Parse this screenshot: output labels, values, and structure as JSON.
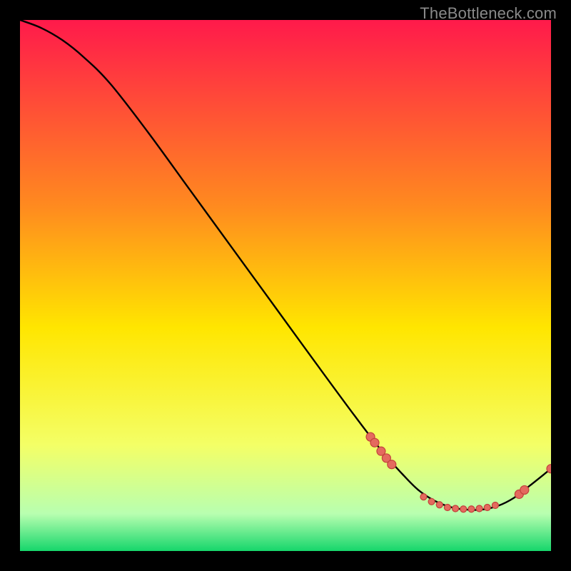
{
  "watermark": "TheBottleneck.com",
  "colors": {
    "bg": "#000000",
    "curve": "#000000",
    "markerFill": "#e46a5e",
    "markerStroke": "#c2403b",
    "gradTop": "#ff1a4b",
    "gradUpperMid": "#ff8a1f",
    "gradMid": "#ffe600",
    "gradLowerMid": "#f4ff66",
    "gradPaleGreen": "#b8ffb0",
    "gradGreen": "#16d66b"
  },
  "chart_data": {
    "type": "line",
    "title": "",
    "xlabel": "",
    "ylabel": "",
    "xlim": [
      0,
      100
    ],
    "ylim": [
      0,
      100
    ],
    "grid": false,
    "series": [
      {
        "name": "bottleneck-curve",
        "x": [
          0,
          4,
          8,
          12,
          17,
          24,
          32,
          40,
          48,
          56,
          63,
          68,
          72,
          75,
          78,
          81,
          84,
          87,
          90,
          93,
          96,
          100
        ],
        "y": [
          100,
          98.5,
          96.2,
          93.0,
          88.0,
          79.0,
          68.0,
          57.0,
          46.0,
          35.0,
          25.5,
          19.0,
          14.5,
          11.5,
          9.5,
          8.3,
          7.8,
          7.8,
          8.5,
          10.0,
          12.3,
          15.5
        ]
      }
    ],
    "markers": [
      {
        "x": 66.0,
        "y": 21.5,
        "r": 6
      },
      {
        "x": 66.8,
        "y": 20.4,
        "r": 6
      },
      {
        "x": 68.0,
        "y": 18.8,
        "r": 6
      },
      {
        "x": 69.0,
        "y": 17.5,
        "r": 6
      },
      {
        "x": 70.0,
        "y": 16.3,
        "r": 6
      },
      {
        "x": 76.0,
        "y": 10.2,
        "r": 4.5
      },
      {
        "x": 77.5,
        "y": 9.3,
        "r": 4.5
      },
      {
        "x": 79.0,
        "y": 8.7,
        "r": 4.5
      },
      {
        "x": 80.5,
        "y": 8.2,
        "r": 4.5
      },
      {
        "x": 82.0,
        "y": 8.0,
        "r": 4.5
      },
      {
        "x": 83.5,
        "y": 7.9,
        "r": 4.5
      },
      {
        "x": 85.0,
        "y": 7.9,
        "r": 4.5
      },
      {
        "x": 86.5,
        "y": 8.0,
        "r": 4.5
      },
      {
        "x": 88.0,
        "y": 8.2,
        "r": 4.5
      },
      {
        "x": 89.5,
        "y": 8.6,
        "r": 4.5
      },
      {
        "x": 94.0,
        "y": 10.7,
        "r": 6
      },
      {
        "x": 95.0,
        "y": 11.5,
        "r": 6
      },
      {
        "x": 100.0,
        "y": 15.5,
        "r": 6
      }
    ]
  }
}
